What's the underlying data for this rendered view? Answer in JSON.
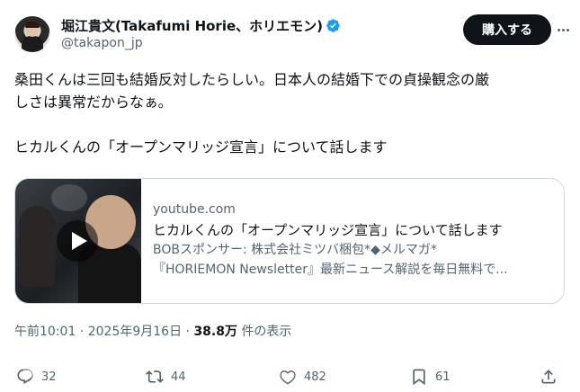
{
  "author": {
    "display_name": "堀江貴文(Takafumi Horie、ホリエモン)",
    "handle": "@takapon_jp"
  },
  "header": {
    "buy_label": "購入する"
  },
  "tweet": {
    "line1": "桑田くんは三回も結婚反対したらしい。日本人の結婚下での貞操観念の厳",
    "line2": "しさは異常だからなぁ。",
    "line3": "ヒカルくんの「オープンマリッジ宣言」について話します"
  },
  "card": {
    "domain": "youtube.com",
    "title": "ヒカルくんの「オープンマリッジ宣言」について話します",
    "desc1": "BOBスポンサー: 株式会社ミツバ梱包*◆メルマガ*",
    "desc2": "『HORIEMON Newsletter』最新ニュース解説を毎日無料で..."
  },
  "meta": {
    "time": "午前10:01",
    "separator": "·",
    "date": "2025年9月16日",
    "views": "38.8万",
    "views_suffix": "件の表示"
  },
  "actions": {
    "replies": "32",
    "reposts": "44",
    "likes": "482",
    "bookmarks": "61"
  },
  "colors": {
    "accent": "#1d9bf0",
    "text": "#0f1419",
    "secondary": "#536471",
    "border": "#cfd9de"
  },
  "icons": [
    "verified-badge-icon",
    "more-icon",
    "play-icon",
    "reply-icon",
    "repost-icon",
    "like-icon",
    "bookmark-icon",
    "share-icon"
  ]
}
